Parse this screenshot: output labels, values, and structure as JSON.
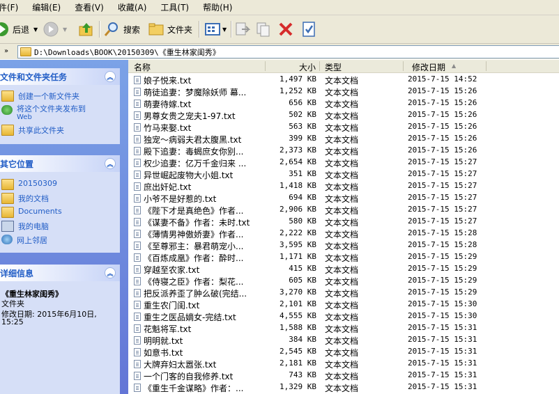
{
  "menu": [
    "件(F)",
    "编辑(E)",
    "查看(V)",
    "收藏(A)",
    "工具(T)",
    "帮助(H)"
  ],
  "toolbar": {
    "back_label": "后退",
    "search_label": "搜索",
    "folders_label": "文件夹"
  },
  "address": {
    "path": "D:\\Downloads\\BOOK\\20150309\\《重生林家闺秀》"
  },
  "sidebar": {
    "tasks": {
      "title": "文件和文件夹任务",
      "items": [
        "创建一个新文件夹",
        "将这个文件夹发布到",
        "Web",
        "共享此文件夹"
      ]
    },
    "places": {
      "title": "其它位置",
      "items": [
        "20150309",
        "我的文档",
        "Documents",
        "我的电脑",
        "网上邻居"
      ]
    },
    "details": {
      "title": "详细信息",
      "name": "《重生林家闺秀》",
      "kind": "文件夹",
      "modified_line1": "修改日期: 2015年6月10日,",
      "modified_line2": "15:25"
    }
  },
  "columns": {
    "name": "名称",
    "size": "大小",
    "type": "类型",
    "modified": "修改日期"
  },
  "files": [
    {
      "name": "娘子悦来.txt",
      "size": "1,497 KB",
      "type": "文本文档",
      "date": "2015-7-15 14:52"
    },
    {
      "name": "萌徒追妻：梦魔除妖师 幕...",
      "size": "1,252 KB",
      "type": "文本文档",
      "date": "2015-7-15 15:26"
    },
    {
      "name": "萌妻待嫁.txt",
      "size": "656 KB",
      "type": "文本文档",
      "date": "2015-7-15 15:26"
    },
    {
      "name": "男尊女贵之宠夫1-97.txt",
      "size": "502 KB",
      "type": "文本文档",
      "date": "2015-7-15 15:26"
    },
    {
      "name": "竹马来娶.txt",
      "size": "563 KB",
      "type": "文本文档",
      "date": "2015-7-15 15:26"
    },
    {
      "name": "独宠～病弱夫君太腹黑.txt",
      "size": "399 KB",
      "type": "文本文档",
      "date": "2015-7-15 15:26"
    },
    {
      "name": "殿下追妻：毒蝎庶女你别...",
      "size": "2,373 KB",
      "type": "文本文档",
      "date": "2015-7-15 15:26"
    },
    {
      "name": "权少追妻：亿万千金归来 ...",
      "size": "2,654 KB",
      "type": "文本文档",
      "date": "2015-7-15 15:27"
    },
    {
      "name": "异世崛起废物大小姐.txt",
      "size": "351 KB",
      "type": "文本文档",
      "date": "2015-7-15 15:27"
    },
    {
      "name": "庶出奸妃.txt",
      "size": "1,418 KB",
      "type": "文本文档",
      "date": "2015-7-15 15:27"
    },
    {
      "name": "小爷不是好惹的.txt",
      "size": "694 KB",
      "type": "文本文档",
      "date": "2015-7-15 15:27"
    },
    {
      "name": "《陛下才是真绝色》作者...",
      "size": "2,906 KB",
      "type": "文本文档",
      "date": "2015-7-15 15:27"
    },
    {
      "name": "《谋妻不备》作者：未时.txt",
      "size": "580 KB",
      "type": "文本文档",
      "date": "2015-7-15 15:27"
    },
    {
      "name": "《薄情男神傲娇妻》作者...",
      "size": "2,222 KB",
      "type": "文本文档",
      "date": "2015-7-15 15:28"
    },
    {
      "name": "《至尊邪主：暴君萌宠小...",
      "size": "3,595 KB",
      "type": "文本文档",
      "date": "2015-7-15 15:28"
    },
    {
      "name": "《百炼成凰》作者：酔时...",
      "size": "1,171 KB",
      "type": "文本文档",
      "date": "2015-7-15 15:29"
    },
    {
      "name": "穿越至农家.txt",
      "size": "415 KB",
      "type": "文本文档",
      "date": "2015-7-15 15:29"
    },
    {
      "name": "《侍寝之臣》作者：梨花...",
      "size": "605 KB",
      "type": "文本文档",
      "date": "2015-7-15 15:29"
    },
    {
      "name": "把反派养歪了肿么破(完结...",
      "size": "3,270 KB",
      "type": "文本文档",
      "date": "2015-7-15 15:29"
    },
    {
      "name": "重生农门闺.txt",
      "size": "2,101 KB",
      "type": "文本文档",
      "date": "2015-7-15 15:30"
    },
    {
      "name": "重生之医品嫡女-完结.txt",
      "size": "4,555 KB",
      "type": "文本文档",
      "date": "2015-7-15 15:30"
    },
    {
      "name": "花魁将军.txt",
      "size": "1,588 KB",
      "type": "文本文档",
      "date": "2015-7-15 15:31"
    },
    {
      "name": "明明就.txt",
      "size": "384 KB",
      "type": "文本文档",
      "date": "2015-7-15 15:31"
    },
    {
      "name": "如意书.txt",
      "size": "2,545 KB",
      "type": "文本文档",
      "date": "2015-7-15 15:31"
    },
    {
      "name": "大牌弃妇太嚣张.txt",
      "size": "2,181 KB",
      "type": "文本文档",
      "date": "2015-7-15 15:31"
    },
    {
      "name": "一个门客的自我修养.txt",
      "size": "743 KB",
      "type": "文本文档",
      "date": "2015-7-15 15:31"
    },
    {
      "name": "《重生千金谋略》作者：...",
      "size": "1,329 KB",
      "type": "文本文档",
      "date": "2015-7-15 15:31"
    }
  ]
}
